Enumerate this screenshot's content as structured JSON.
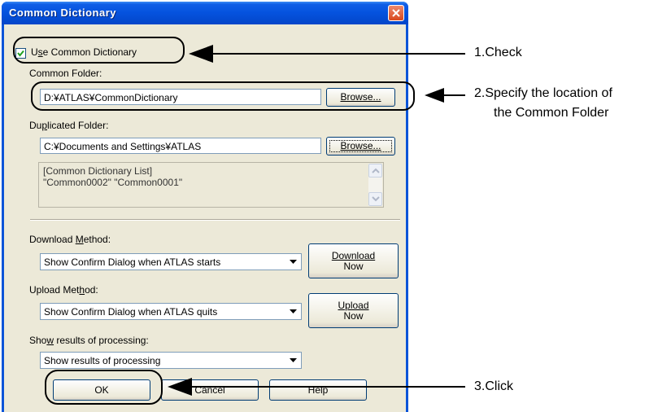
{
  "dialog": {
    "title": "Common Dictionary",
    "use_common_checkbox": {
      "label_pre": "U",
      "label_u": "s",
      "label_post": "e Common Dictionary",
      "checked": true
    },
    "common_folder": {
      "label": "Common Folder:",
      "value": "D:¥ATLAS¥CommonDictionary",
      "browse_label": "Browse..."
    },
    "duplicated_folder": {
      "label_pre": "Du",
      "label_u": "p",
      "label_post": "licated Folder:",
      "value": "C:¥Documents and Settings¥ATLAS",
      "browse_label": "Browse..."
    },
    "dictionary_list": {
      "line1": "[Common Dictionary List]",
      "line2": "\"Common0002\"  \"Common0001\""
    },
    "download": {
      "label_pre": "Download ",
      "label_u": "M",
      "label_post": "ethod:",
      "selected": "Show Confirm Dialog when ATLAS starts",
      "button_line1": "Download",
      "button_line2": "Now"
    },
    "upload": {
      "label_pre": "Upload Met",
      "label_u": "h",
      "label_post": "od:",
      "selected": "Show Confirm Dialog when ATLAS quits",
      "button_line1": "Upload",
      "button_line2": "Now"
    },
    "results": {
      "label_pre": "Sho",
      "label_u": "w",
      "label_post": " results of processing:",
      "selected": "Show results of processing"
    },
    "buttons": {
      "ok": "OK",
      "cancel": "Cancel",
      "help": "Help"
    }
  },
  "annotations": {
    "step1": "1.Check",
    "step2_line1": "2.Specify the location of",
    "step2_line2": "the Common Folder",
    "step3": "3.Click"
  },
  "colors": {
    "titlebar": "#0552de",
    "dialog_face": "#ece9d8",
    "close_button": "#d9481d"
  }
}
